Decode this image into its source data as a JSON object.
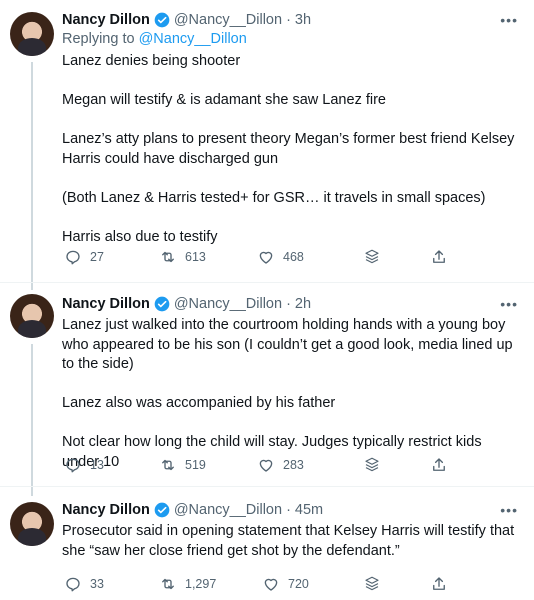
{
  "colors": {
    "accent": "#1d9bf0",
    "muted": "#536471",
    "text": "#0f1419"
  },
  "tweets": [
    {
      "name": "Nancy Dillon",
      "handle": "@Nancy__Dillon · 3h",
      "reply_prefix": "Replying to",
      "reply_handle": "@Nancy__Dillon",
      "paragraphs": [
        "Lanez denies being shooter",
        "Megan will testify & is adamant she saw Lanez fire",
        "Lanez’s atty plans to present theory Megan’s former best friend Kelsey Harris could have discharged gun",
        "(Both Lanez & Harris tested+ for GSR… it travels in small spaces)",
        "Harris also due to testify"
      ],
      "replies": "27",
      "retweets": "613",
      "likes": "468"
    },
    {
      "name": "Nancy Dillon",
      "handle": "@Nancy__Dillon · 2h",
      "paragraphs": [
        "Lanez just walked into the courtroom holding hands with a young boy who appeared to be his son (I couldn’t get a good look, media lined up  to the side)",
        "Lanez also was accompanied by his father",
        "Not clear how long the child will stay. Judges typically restrict kids under 10"
      ],
      "replies": "13",
      "retweets": "519",
      "likes": "283"
    },
    {
      "name": "Nancy Dillon",
      "handle": "@Nancy__Dillon · 45m",
      "paragraphs": [
        "Prosecutor said in opening statement that Kelsey Harris will testify that she “saw her close friend get shot by the defendant.”"
      ],
      "replies": "33",
      "retweets": "1,297",
      "likes": "720"
    }
  ]
}
